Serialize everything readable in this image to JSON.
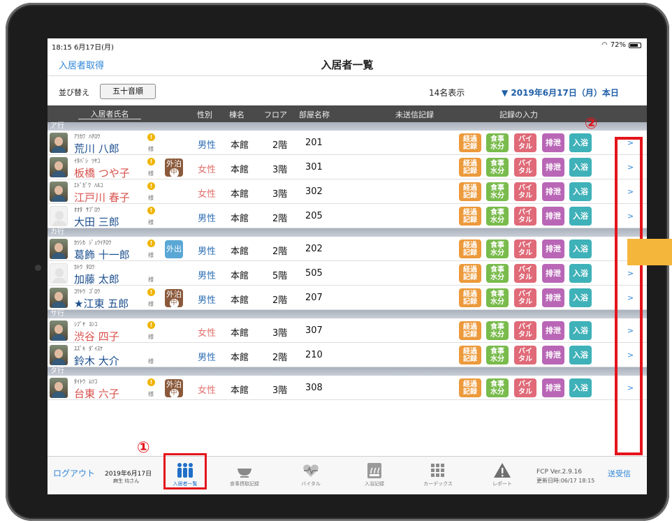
{
  "status_bar": {
    "time": "18:15  6月17日(月)",
    "battery": "72%"
  },
  "nav": {
    "left_button": "入居者取得",
    "title": "入居者一覧"
  },
  "toolbar": {
    "sort_label": "並び替え",
    "sort_button": "五十音順",
    "count": "14名表示",
    "date": "▼ 2019年6月17日（月）本日"
  },
  "columns": {
    "name": "入居者氏名",
    "sex": "性別",
    "building": "棟名",
    "floor": "フロア",
    "room": "部屋名称",
    "unsent": "未送信記録",
    "input": "記録の入力"
  },
  "record_buttons": {
    "keika": [
      "経過",
      "記録"
    ],
    "shokuji": [
      "食事",
      "水分"
    ],
    "vital": [
      "バイ",
      "タル"
    ],
    "haisetsu": "排泄",
    "nyuyoku": "入浴"
  },
  "alert_symbol": "!",
  "honorific": "様",
  "chevron": ">",
  "sections": [
    {
      "label": "ア行",
      "rows": [
        {
          "kana": "ｱﾗｶﾜ  ﾊﾁﾛｳ",
          "name": "荒川 八郎",
          "gender": "m",
          "alert": true,
          "sex": "男性",
          "building": "本館",
          "floor": "2階",
          "room": "201",
          "avatar": true
        },
        {
          "kana": "ｲﾀﾊﾞｼ  ﾂﾔｺ",
          "name": "板橋 つや子",
          "gender": "f",
          "alert": true,
          "status": "gaihaku",
          "sex": "女性",
          "building": "本館",
          "floor": "3階",
          "room": "301",
          "avatar": true
        },
        {
          "kana": "ｴﾄﾞｶﾞﾜ  ﾊﾙｺ",
          "name": "江戸川 春子",
          "gender": "f",
          "alert": true,
          "sex": "女性",
          "building": "本館",
          "floor": "3階",
          "room": "302",
          "avatar": true
        },
        {
          "kana": "ｵｵﾀ  ｻﾌﾞﾛｳ",
          "name": "大田 三郎",
          "gender": "m",
          "alert": true,
          "sex": "男性",
          "building": "本館",
          "floor": "2階",
          "room": "205",
          "avatar": false
        }
      ]
    },
    {
      "label": "カ行",
      "rows": [
        {
          "kana": "ｶﾂｼｶ  ｼﾞｭｳｲﾁﾛｳ",
          "name": "葛飾 十一郎",
          "gender": "m",
          "alert": true,
          "status": "gaishutsu",
          "sex": "男性",
          "building": "本館",
          "floor": "2階",
          "room": "202",
          "avatar": true
        },
        {
          "kana": "ｶﾄｳ  ﾀﾛｳ",
          "name": "加藤 太郎",
          "gender": "m",
          "alert": false,
          "sex": "男性",
          "building": "本館",
          "floor": "5階",
          "room": "505",
          "avatar": false
        },
        {
          "kana": "ｺｳﾄｳ  ｺﾞﾛｳ",
          "name": "★江東 五郎",
          "gender": "m",
          "alert": true,
          "status": "gaihaku",
          "sex": "男性",
          "building": "本館",
          "floor": "2階",
          "room": "207",
          "avatar": true
        }
      ]
    },
    {
      "label": "サ行",
      "rows": [
        {
          "kana": "ｼﾌﾞﾔ  ﾖﾝｺ",
          "name": "渋谷 四子",
          "gender": "f",
          "alert": true,
          "sex": "女性",
          "building": "本館",
          "floor": "3階",
          "room": "307",
          "avatar": true
        },
        {
          "kana": "ｽｽﾞｷ  ﾀﾞｲｽｹ",
          "name": "鈴木 大介",
          "gender": "m",
          "alert": false,
          "sex": "男性",
          "building": "本館",
          "floor": "2階",
          "room": "210",
          "avatar": true
        }
      ]
    },
    {
      "label": "タ行",
      "rows": [
        {
          "kana": "ﾀｲﾄｳ  ﾑﾂｺ",
          "name": "台東 六子",
          "gender": "f",
          "alert": true,
          "status": "gaihaku",
          "sex": "女性",
          "building": "本館",
          "floor": "3階",
          "room": "308",
          "avatar": true
        }
      ]
    }
  ],
  "badges": {
    "gaihaku_top": "外泊",
    "gaihaku_mid": "中",
    "gaishutsu": "外出"
  },
  "annotations": {
    "marker1": "①",
    "marker2": "②"
  },
  "tabbar": {
    "logout": "ログアウト",
    "date": "2019年6月17日",
    "user": "麻生 均さん",
    "tabs": [
      "入居者一覧",
      "食事摂取記録",
      "バイタル",
      "入浴記録",
      "カーデックス",
      "レポート"
    ],
    "version": "FCP Ver.2.9.16",
    "updated": "更新日時:06/17 18:15",
    "send": "送受信"
  },
  "colors": {
    "accent": "#2f86d8",
    "annotation_red": "#e4141b"
  }
}
